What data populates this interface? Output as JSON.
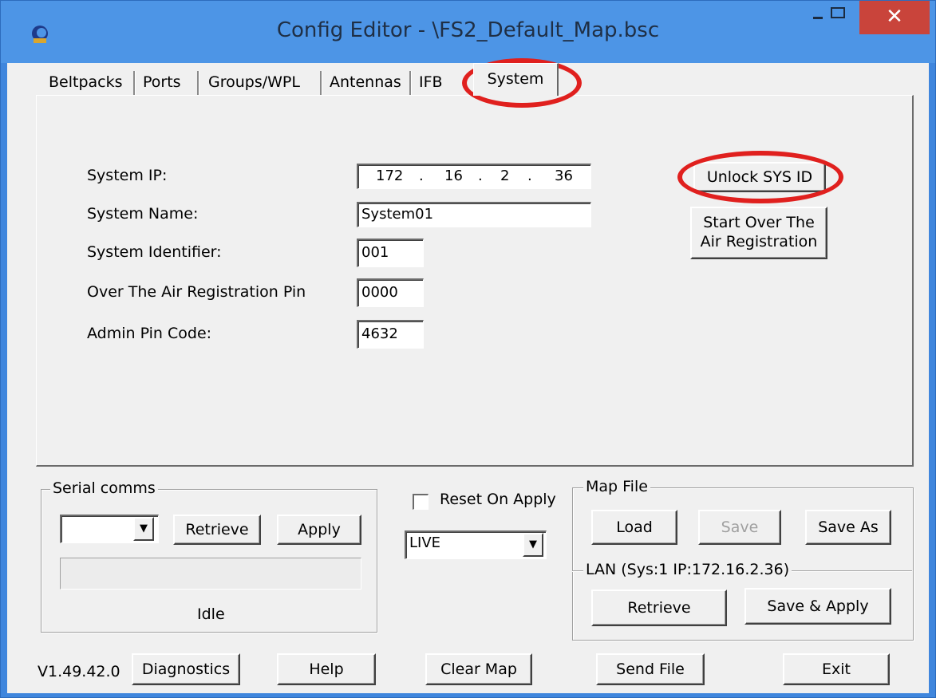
{
  "window": {
    "title": "Config Editor - \\FS2_Default_Map.bsc",
    "close_glyph": "✕"
  },
  "tabs": [
    {
      "label": "Beltpacks"
    },
    {
      "label": "Ports"
    },
    {
      "label": "Groups/WPL"
    },
    {
      "label": "Antennas"
    },
    {
      "label": "IFB"
    },
    {
      "label": "System"
    }
  ],
  "system": {
    "ip_label": "System IP:",
    "ip_octets": [
      "172",
      "16",
      "2",
      "36"
    ],
    "ip_dot": ".",
    "name_label": "System Name:",
    "name_value": "System01",
    "identifier_label": "System Identifier:",
    "identifier_value": "001",
    "ota_pin_label": "Over The Air Registration Pin",
    "ota_pin_value": "0000",
    "admin_pin_label": "Admin Pin Code:",
    "admin_pin_value": "4632",
    "unlock_button": "Unlock SYS ID",
    "start_over_line1": "Start Over The",
    "start_over_line2": "Air Registration"
  },
  "serial": {
    "group_title": "Serial comms",
    "port_value": "",
    "retrieve_button": "Retrieve",
    "apply_button": "Apply",
    "status": "Idle"
  },
  "reset": {
    "label": "Reset On Apply",
    "checked": false
  },
  "mode": {
    "value": "LIVE"
  },
  "map_file": {
    "group_title": "Map File",
    "load_button": "Load",
    "save_button": "Save",
    "save_as_button": "Save As"
  },
  "lan": {
    "group_title": "LAN  (Sys:1 IP:172.16.2.36)",
    "retrieve_button": "Retrieve",
    "save_apply_button": "Save & Apply"
  },
  "footer": {
    "version": "V1.49.42.0",
    "diagnostics_button": "Diagnostics",
    "help_button": "Help",
    "clear_map_button": "Clear Map",
    "send_file_button": "Send File",
    "exit_button": "Exit"
  },
  "colors": {
    "annotation_red": "#e0201e",
    "titlebar": "#4d95e6",
    "close": "#c9443b"
  }
}
